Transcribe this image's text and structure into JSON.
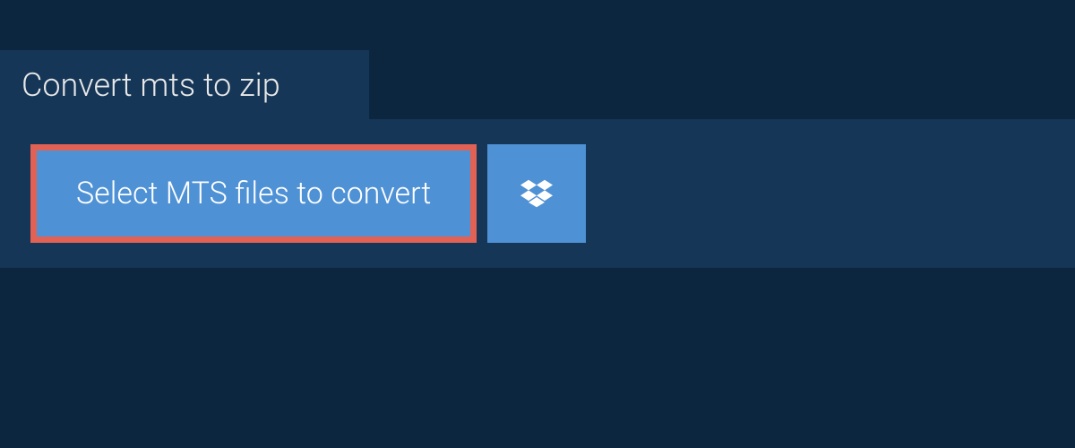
{
  "tab": {
    "title": "Convert mts to zip"
  },
  "actions": {
    "select_files_label": "Select MTS files to convert"
  }
}
